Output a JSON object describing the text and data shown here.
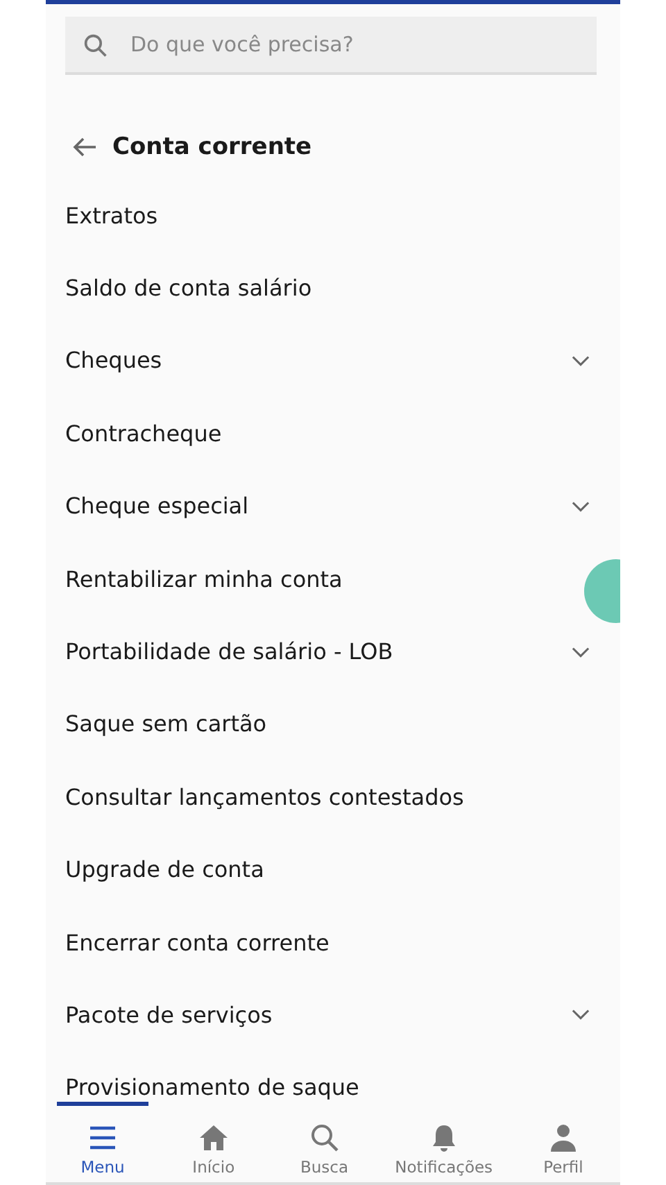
{
  "search": {
    "placeholder": "Do que você precisa?"
  },
  "header": {
    "title": "Conta corrente"
  },
  "items": [
    {
      "label": "Extratos",
      "expandable": false
    },
    {
      "label": "Saldo de conta salário",
      "expandable": false
    },
    {
      "label": "Cheques",
      "expandable": true
    },
    {
      "label": "Contracheque",
      "expandable": false
    },
    {
      "label": "Cheque especial",
      "expandable": true
    },
    {
      "label": "Rentabilizar minha conta",
      "expandable": false
    },
    {
      "label": "Portabilidade de salário - LOB",
      "expandable": true
    },
    {
      "label": "Saque sem cartão",
      "expandable": false
    },
    {
      "label": "Consultar lançamentos contestados",
      "expandable": false
    },
    {
      "label": "Upgrade de conta",
      "expandable": false
    },
    {
      "label": "Encerrar conta corrente",
      "expandable": false
    },
    {
      "label": "Pacote de serviços",
      "expandable": true
    },
    {
      "label": "Provisionamento de saque",
      "expandable": false
    }
  ],
  "nav": [
    {
      "label": "Menu",
      "kind": "menu",
      "selected": true
    },
    {
      "label": "Início",
      "kind": "home",
      "selected": false
    },
    {
      "label": "Busca",
      "kind": "search",
      "selected": false
    },
    {
      "label": "Notificações",
      "kind": "bell",
      "selected": false
    },
    {
      "label": "Perfil",
      "kind": "person",
      "selected": false
    }
  ]
}
